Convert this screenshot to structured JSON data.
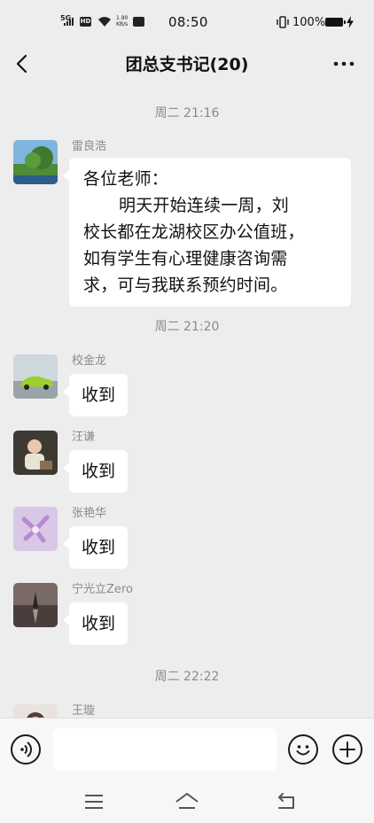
{
  "status_bar": {
    "network": "5G",
    "hd": "HD",
    "speed_value": "1.90",
    "speed_unit": "KB/s",
    "time": "08:50",
    "battery": "100%"
  },
  "nav": {
    "title": "团总支书记(20)",
    "back_icon": "chevron-left-icon",
    "more_icon": "more-dots-icon"
  },
  "chat": {
    "timestamps": [
      "周二 21:16",
      "周二 21:20",
      "周二 22:22"
    ],
    "messages": [
      {
        "sender": "雷良浩",
        "lines": [
          "各位老师：",
          "明天开始连续一周，刘",
          "校长都在龙湖校区办公值班，",
          "如有学生有心理健康咨询需",
          "求，可与我联系预约时间。"
        ]
      },
      {
        "sender": "校金龙",
        "text": "收到"
      },
      {
        "sender": "汪谦",
        "text": "收到"
      },
      {
        "sender": "张艳华",
        "text": "收到"
      },
      {
        "sender": "宁光立Zero",
        "text": "收到"
      },
      {
        "sender": "王璇"
      }
    ]
  },
  "input_bar": {
    "voice_icon": "voice-icon",
    "text_value": "",
    "emoji_icon": "emoji-icon",
    "plus_icon": "plus-icon"
  },
  "system_nav": {
    "menu_icon": "menu-icon",
    "home_icon": "home-icon",
    "back_icon": "back-icon"
  }
}
